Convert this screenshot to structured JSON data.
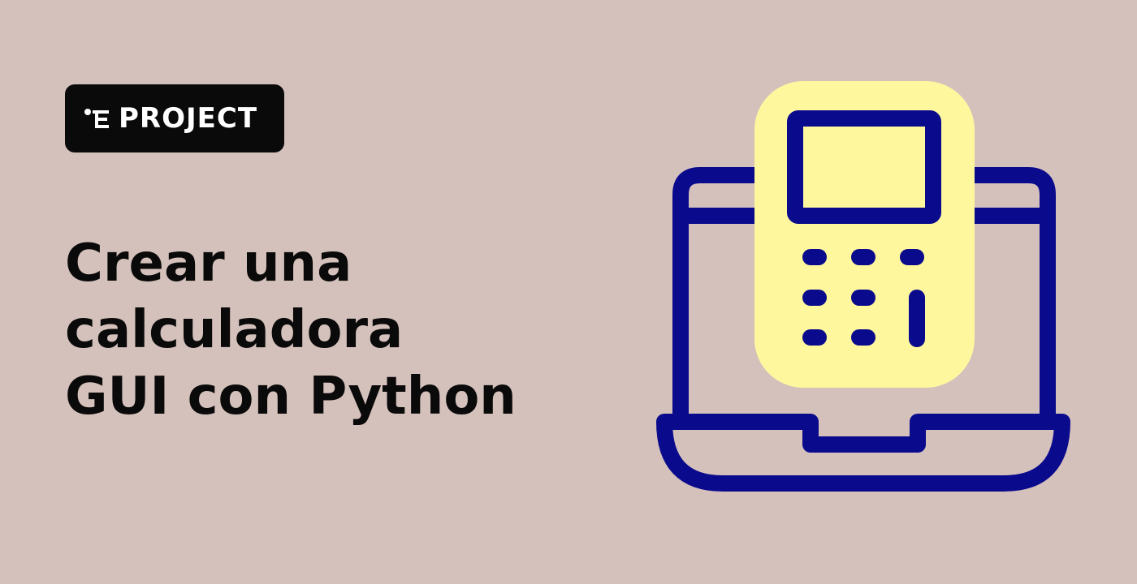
{
  "colors": {
    "background": "#d5c1bc",
    "badge_bg": "#0a0a0a",
    "badge_text": "#ffffff",
    "title_text": "#0a0a0a",
    "illustration_stroke": "#0a0a8c",
    "calculator_fill": "#fff79e"
  },
  "badge": {
    "icon": "project-tree-icon",
    "label": "PROJECT"
  },
  "title": {
    "lines": [
      "Crear una",
      "calculadora",
      "GUI con Python"
    ]
  },
  "illustration": {
    "name": "laptop-calculator-icon"
  }
}
